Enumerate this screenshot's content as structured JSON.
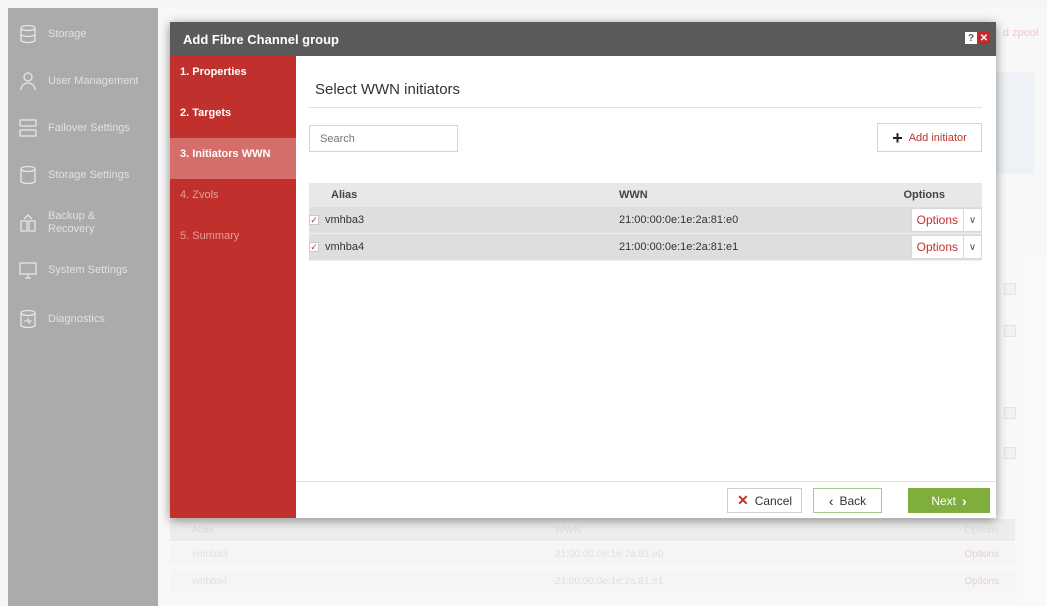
{
  "app": {
    "sidebar": {
      "items": [
        {
          "label": "Storage",
          "icon": "storage-icon"
        },
        {
          "label": "User Management",
          "icon": "user-icon"
        },
        {
          "label": "Failover Settings",
          "icon": "failover-icon"
        },
        {
          "label": "Storage Settings",
          "icon": "storage-settings-icon"
        },
        {
          "label": "Backup &\nRecovery",
          "icon": "backup-icon"
        },
        {
          "label": "System Settings",
          "icon": "system-icon"
        },
        {
          "label": "Diagnostics",
          "icon": "diagnostics-icon"
        }
      ]
    },
    "background": {
      "header_link": "d zpool",
      "table": {
        "headers": [
          "Alias",
          "WWN",
          "Options"
        ],
        "rows": [
          {
            "alias": "vmhba3",
            "wwn": "21:00:00:0e:1e:2a:81:e0",
            "options": "Options"
          },
          {
            "alias": "vmhba4",
            "wwn": "21:00:00:0e:1e:2a:81:e1",
            "options": "Options"
          }
        ]
      }
    }
  },
  "modal": {
    "title": "Add Fibre Channel group",
    "steps": [
      {
        "label": "1. Properties",
        "state": "done"
      },
      {
        "label": "2. Targets",
        "state": "done"
      },
      {
        "label": "3. Initiators WWN",
        "state": "active"
      },
      {
        "label": "4. Zvols",
        "state": "disabled"
      },
      {
        "label": "5. Summary",
        "state": "disabled"
      }
    ],
    "heading": "Select WWN initiators",
    "search": {
      "placeholder": "Search"
    },
    "add_button": "Add initiator",
    "table": {
      "headers": {
        "alias": "Alias",
        "wwn": "WWN",
        "options": "Options"
      },
      "rows": [
        {
          "checked": true,
          "alias": "vmhba3",
          "wwn": "21:00:00:0e:1e:2a:81:e0",
          "options": "Options"
        },
        {
          "checked": true,
          "alias": "vmhba4",
          "wwn": "21:00:00:0e:1e:2a:81:e1",
          "options": "Options"
        }
      ]
    },
    "buttons": {
      "cancel": "Cancel",
      "back": "Back",
      "next": "Next"
    }
  },
  "colors": {
    "accent_red": "#c0302c",
    "next_green": "#7fae3c",
    "title_bar": "#5a5a5a"
  }
}
